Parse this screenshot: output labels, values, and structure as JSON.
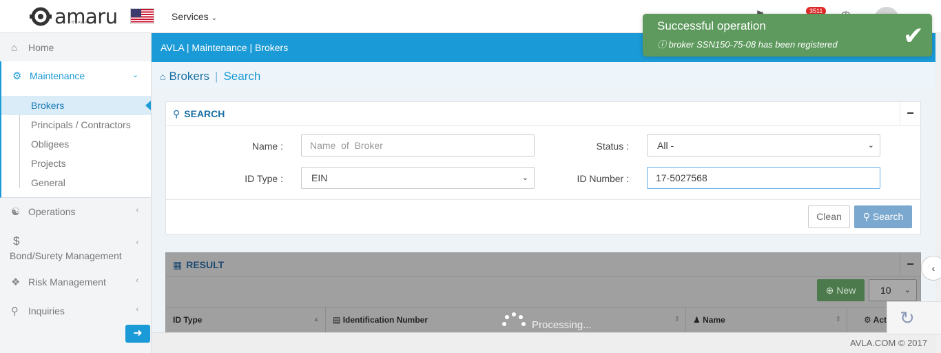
{
  "header": {
    "logo_text": "amaru",
    "logo_sub": "BY AVLA",
    "services_label": "Services",
    "notification_count": "3511"
  },
  "sidebar": {
    "home": "Home",
    "maintenance": "Maintenance",
    "submenu": [
      "Brokers",
      "Principals / Contractors",
      "Obligees",
      "Projects",
      "General"
    ],
    "operations": "Operations",
    "bond": "Bond/Surety Management",
    "risk": "Risk Management",
    "inquiries": "Inquiries"
  },
  "breadcrumb": "AVLA | Maintenance | Brokers",
  "page": {
    "title": "Brokers",
    "subtitle": "Search"
  },
  "search": {
    "title": "SEARCH",
    "name_label": "Name :",
    "name_placeholder": "Name  of  Broker",
    "status_label": "Status :",
    "status_value": "All -",
    "idtype_label": "ID Type :",
    "idtype_value": "EIN",
    "idnumber_label": "ID Number :",
    "idnumber_value": "17-5027568",
    "clean_label": "Clean",
    "search_label": "Search"
  },
  "result": {
    "title": "RESULT",
    "new_label": "New",
    "page_size": "10",
    "columns": [
      "ID Type",
      "Identification Number",
      "Name",
      "Act"
    ],
    "processing": "Processing..."
  },
  "footer": "AVLA.COM © 2017",
  "toast": {
    "title": "Successful operation",
    "message": "broker SSN150-75-08 has been registered"
  },
  "colors": {
    "primary": "#1a9ad6",
    "success": "#5e9a5e",
    "badge": "#e02a2a"
  }
}
